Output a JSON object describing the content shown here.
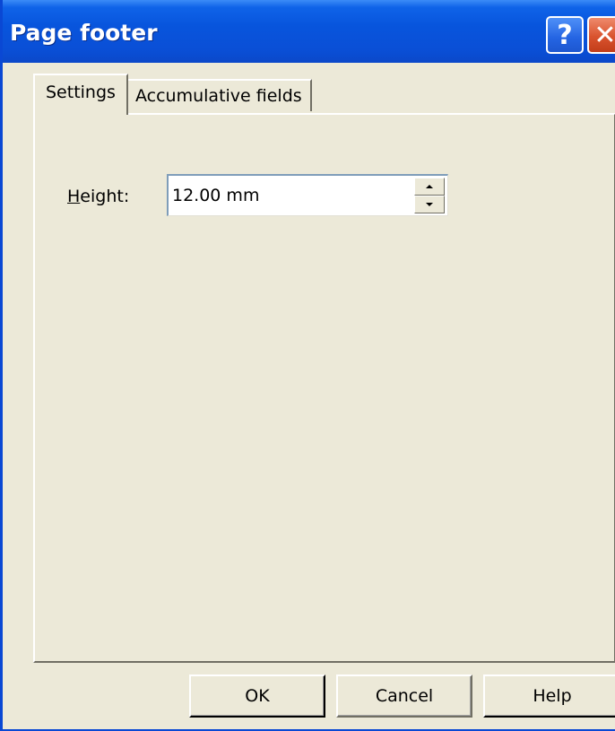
{
  "window": {
    "title": "Page footer",
    "help_glyph": "?",
    "close_glyph": "✕",
    "icons": {
      "help": "help-icon",
      "close": "close-icon",
      "spin_up": "spin-up-arrow-icon",
      "spin_down": "spin-down-arrow-icon"
    },
    "colors": {
      "titlebar": "#0855dd",
      "dialog_background": "#ece9d8",
      "close_button": "#d9532e"
    }
  },
  "tabs": [
    {
      "label": "Settings",
      "selected": true
    },
    {
      "label": "Accumulative fields",
      "selected": false
    }
  ],
  "settings": {
    "height_label_mnemonic": "H",
    "height_label_rest": "eight:",
    "height_value": "12.00 mm"
  },
  "buttons": {
    "ok": "OK",
    "cancel": "Cancel",
    "help": "Help"
  }
}
